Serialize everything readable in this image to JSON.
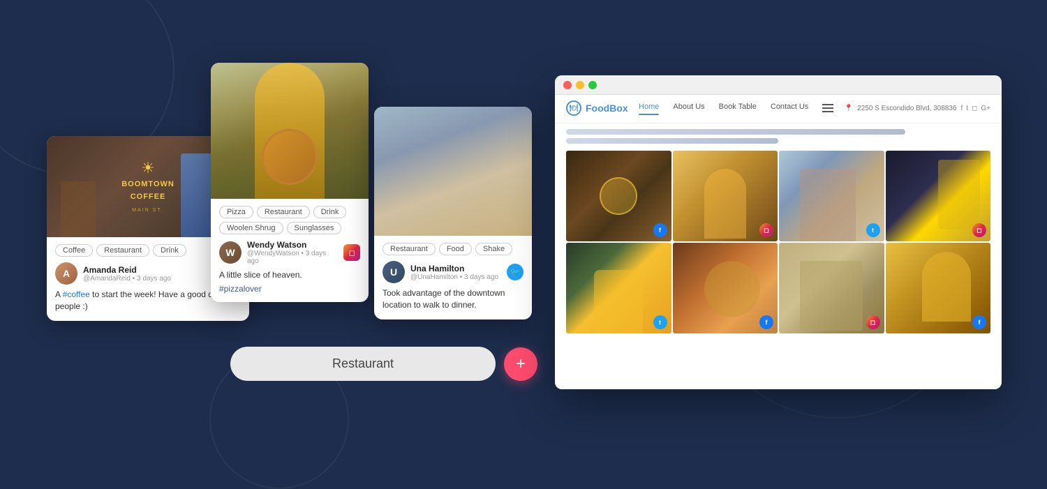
{
  "background": "#1e2d4d",
  "card1": {
    "tags": [
      "Coffee",
      "Restaurant",
      "Drink"
    ],
    "username": "Amanda Reid",
    "handle": "@AmandaReid",
    "timestamp": "3 days ago",
    "text": "A ",
    "hashtag": "#coffee",
    "text2": " to start the week! Have a good day, people :)",
    "social": "facebook"
  },
  "card2": {
    "tags": [
      "Pizza",
      "Restaurant",
      "Drink",
      "Woolen Shrug",
      "Sunglasses"
    ],
    "username": "Wendy Watson",
    "handle": "@WendyWatson",
    "timestamp": "3 days ago",
    "text": "A little slice of heaven.",
    "hashtag": "#pizzalover",
    "social": "instagram"
  },
  "card3": {
    "tags": [
      "Restaurant",
      "Food",
      "Shake"
    ],
    "username": "Una Hamilton",
    "handle": "@UnaHamilton",
    "timestamp": "3 days ago",
    "text": "Took advantage of the downtown location to walk to dinner.",
    "social": "twitter"
  },
  "pill": {
    "label": "Restaurant"
  },
  "browser": {
    "brand": "FoodBox",
    "address": "2250 S Escondido Blvd, 308836",
    "nav": {
      "home": "Home",
      "about": "About Us",
      "book": "Book Table",
      "contact": "Contact Us"
    },
    "grid": {
      "cells": [
        {
          "social": "facebook"
        },
        {
          "social": "instagram"
        },
        {
          "social": "twitter"
        },
        {
          "social": "instagram"
        },
        {
          "social": "twitter"
        },
        {
          "social": "facebook"
        },
        {
          "social": "instagram"
        },
        {
          "social": "facebook"
        }
      ]
    }
  }
}
